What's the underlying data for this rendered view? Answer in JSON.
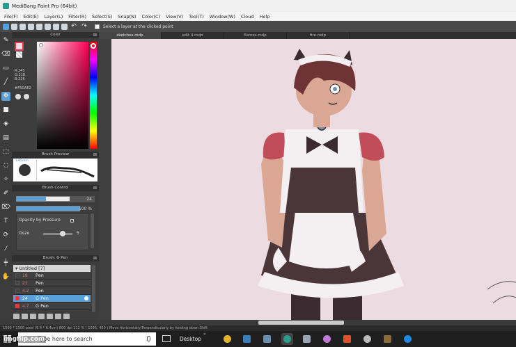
{
  "window": {
    "title": "MediBang Paint Pro (64bit)"
  },
  "menu": [
    "File(F)",
    "Edit(E)",
    "Layer(L)",
    "Filter(R)",
    "Select(S)",
    "Snap(N)",
    "Color(C)",
    "View(V)",
    "Tool(T)",
    "Window(W)",
    "Cloud",
    "Help"
  ],
  "toolbar": {
    "select_layer_label": "Select a layer at the clicked point"
  },
  "tools": [
    "brush-tool-icon",
    "eraser-tool-icon",
    "rectangle-tool-icon",
    "line-tool-icon",
    "move-tool-icon",
    "fill-rect-tool-icon",
    "bucket-tool-icon",
    "gradient-tool-icon",
    "select-rect-tool-icon",
    "lasso-tool-icon",
    "magic-wand-tool-icon",
    "select-pen-tool-icon",
    "select-eraser-tool-icon",
    "text-tool-icon",
    "operation-tool-icon",
    "eyedropper-tool-icon",
    "divide-tool-icon",
    "hand-tool-icon"
  ],
  "color_panel": {
    "title": "Color",
    "r": "R:245",
    "g": "G:218",
    "b": "B:226",
    "hex": "#F5DAE2",
    "fg_color": "#F5DAE2",
    "fg_border": "#E23B4E"
  },
  "brush_preview": {
    "title": "Brush Preview",
    "size_label": "1.05mm"
  },
  "brush_control": {
    "title": "Brush Control",
    "size_value": "24",
    "size_fraction": 0.47,
    "opacity_value": "100 %",
    "opacity_fraction": 1.0,
    "opacity_by_pressure": "Opacity by Pressure",
    "ooze_label": "Ooze",
    "ooze_value": "5"
  },
  "layers": {
    "title": "Brush: G Pen",
    "group": "Untitled [7]",
    "rows": [
      {
        "opacity": "19",
        "name": "Pen",
        "selected": false,
        "visible": false
      },
      {
        "opacity": "21",
        "name": "Pen",
        "selected": false,
        "visible": false
      },
      {
        "opacity": "4.2",
        "name": "Pen",
        "selected": false,
        "visible": false
      },
      {
        "opacity": "24",
        "name": "G Pen",
        "selected": true,
        "visible": true
      },
      {
        "opacity": "4.7",
        "name": "G Pen",
        "selected": false,
        "visible": true
      }
    ]
  },
  "tabs": [
    "sketches.mdp",
    "edit 4.mdp",
    "flames.mdp",
    "fire.mdp"
  ],
  "active_tab": 0,
  "statusbar": {
    "text": "1500 * 1500 pixel   (6.4 * 6.4cm)   600 dpi   112 %   ( 1095, 450 )   Move Horizontally/Perpendicularly by holding down Shift"
  },
  "taskbar": {
    "search_placeholder": "Type here to search",
    "desktop_label": "Desktop"
  },
  "watermark": "imgflip.com",
  "colors": {
    "canvas": "#ECDCE1",
    "accent": "#5AA0D8"
  }
}
